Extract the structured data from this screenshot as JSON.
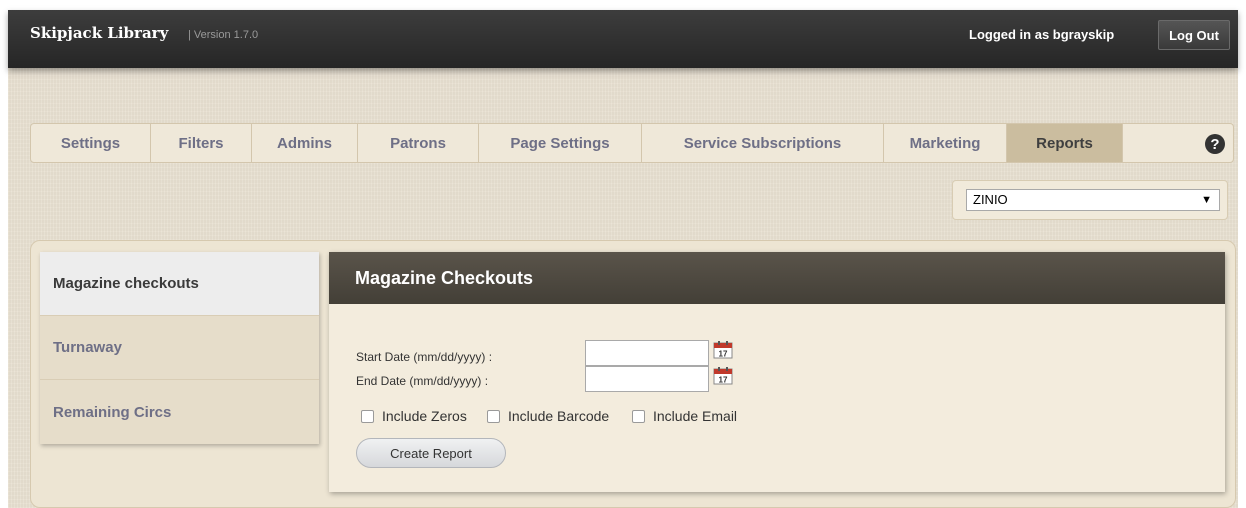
{
  "header": {
    "brand": "Skipjack Library",
    "version": "| Version 1.7.0",
    "user_text": "Logged in as bgrayskip",
    "logout_label": "Log Out"
  },
  "tabs": [
    {
      "label": "Settings",
      "active": false
    },
    {
      "label": "Filters",
      "active": false
    },
    {
      "label": "Admins",
      "active": false
    },
    {
      "label": "Patrons",
      "active": false
    },
    {
      "label": "Page Settings",
      "active": false
    },
    {
      "label": "Service Subscriptions",
      "active": false
    },
    {
      "label": "Marketing",
      "active": false
    },
    {
      "label": "Reports",
      "active": true
    }
  ],
  "help": {
    "icon": "help-icon",
    "glyph": "?"
  },
  "service_select": {
    "value": "ZINIO",
    "arrow": "▼"
  },
  "sidebar": {
    "items": [
      {
        "label": "Magazine checkouts",
        "active": true
      },
      {
        "label": "Turnaway",
        "active": false
      },
      {
        "label": "Remaining Circs",
        "active": false
      }
    ]
  },
  "report": {
    "title": "Magazine Checkouts",
    "start_label": "Start Date (mm/dd/yyyy) :",
    "end_label": "End Date (mm/dd/yyyy) :",
    "start_value": "",
    "end_value": "",
    "calendar_day": "17",
    "checkboxes": [
      {
        "label": "Include Zeros",
        "checked": false
      },
      {
        "label": "Include Barcode",
        "checked": false
      },
      {
        "label": "Include Email",
        "checked": false
      }
    ],
    "create_label": "Create Report"
  },
  "colors": {
    "topbar": "#2e2e2e",
    "page_bg": "#e9e1d2",
    "tab_text": "#6e6f86",
    "active_tab_bg": "#cbbd9f",
    "panel_header": "#4e4941",
    "calendar_red": "#c0392b"
  }
}
